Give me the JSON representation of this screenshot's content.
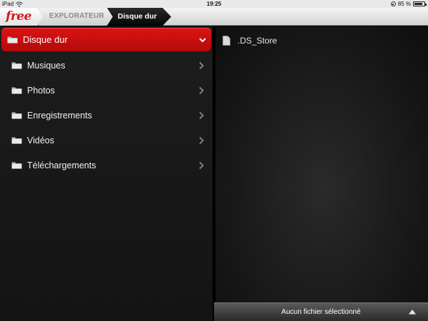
{
  "status_bar": {
    "device": "iPad",
    "time": "19:25",
    "battery": "85 %",
    "battery_level": 0.85
  },
  "nav": {
    "logo": "free",
    "breadcrumb": [
      "EXPLORATEUR",
      "Disque dur"
    ]
  },
  "sidebar": {
    "items": [
      {
        "label": "Disque dur",
        "selected": true
      },
      {
        "label": "Musiques",
        "selected": false
      },
      {
        "label": "Photos",
        "selected": false
      },
      {
        "label": "Enregistrements",
        "selected": false
      },
      {
        "label": "Vidéos",
        "selected": false
      },
      {
        "label": "Téléchargements",
        "selected": false
      }
    ]
  },
  "files": [
    {
      "name": ".DS_Store"
    }
  ],
  "footer": {
    "status": "Aucun fichier sélectionné"
  },
  "colors": {
    "accent": "#c80f0f",
    "logo": "#d4161b",
    "panel": "#181818"
  }
}
